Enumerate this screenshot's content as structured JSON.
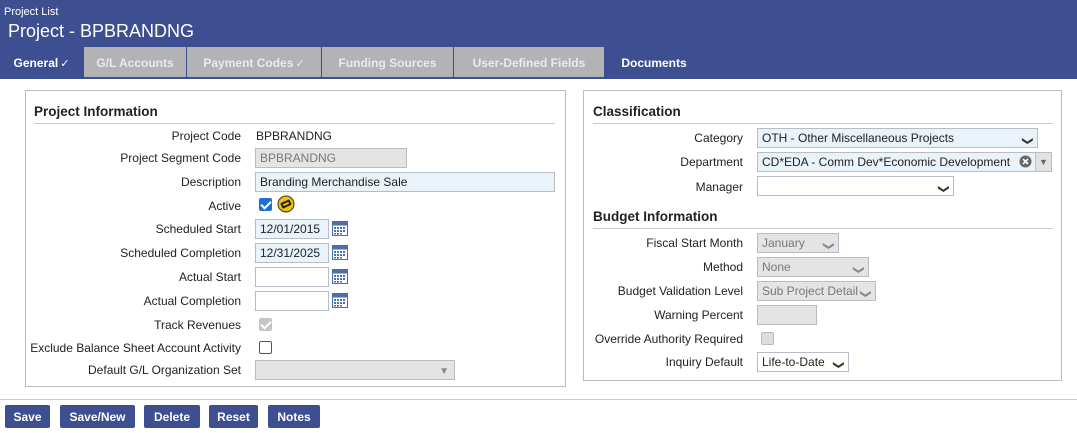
{
  "header": {
    "breadcrumb": "Project List",
    "title": "Project - BPBRANDNG"
  },
  "tabs": [
    {
      "label": "General",
      "check": "✓"
    },
    {
      "label": "G/L Accounts",
      "check": ""
    },
    {
      "label": "Payment Codes",
      "check": "✓"
    },
    {
      "label": "Funding Sources",
      "check": ""
    },
    {
      "label": "User-Defined Fields",
      "check": ""
    },
    {
      "label": "Documents",
      "check": ""
    }
  ],
  "project_info": {
    "title": "Project Information",
    "project_code_label": "Project Code",
    "project_code_value": "BPBRANDNG",
    "segment_code_label": "Project Segment Code",
    "segment_code_value": "BPBRANDNG",
    "description_label": "Description",
    "description_value": "Branding Merchandise Sale",
    "active_label": "Active",
    "active_checked": true,
    "scheduled_start_label": "Scheduled Start",
    "scheduled_start_value": "12/01/2015",
    "scheduled_completion_label": "Scheduled Completion",
    "scheduled_completion_value": "12/31/2025",
    "actual_start_label": "Actual Start",
    "actual_start_value": "",
    "actual_completion_label": "Actual Completion",
    "actual_completion_value": "",
    "track_revenues_label": "Track Revenues",
    "track_revenues_checked": true,
    "exclude_bs_label": "Exclude Balance Sheet Account Activity",
    "exclude_bs_checked": false,
    "default_org_set_label": "Default G/L Organization Set",
    "default_org_set_value": ""
  },
  "classification": {
    "title": "Classification",
    "category_label": "Category",
    "category_value": "OTH - Other Miscellaneous Projects",
    "department_label": "Department",
    "department_value": "CD*EDA - Comm Dev*Economic Development",
    "manager_label": "Manager",
    "manager_value": ""
  },
  "budget_info": {
    "title": "Budget Information",
    "fiscal_start_label": "Fiscal Start Month",
    "fiscal_start_value": "January",
    "method_label": "Method",
    "method_value": "None",
    "validation_label": "Budget Validation Level",
    "validation_value": "Sub Project Detail",
    "warning_label": "Warning Percent",
    "warning_value": "",
    "override_label": "Override Authority Required",
    "override_checked": false,
    "inquiry_label": "Inquiry Default",
    "inquiry_value": "Life-to-Date"
  },
  "buttons": {
    "save": "Save",
    "save_new": "Save/New",
    "delete": "Delete",
    "reset": "Reset",
    "notes": "Notes"
  },
  "colors": {
    "header": "#3d4f91",
    "tab_inactive": "#b3b3b6",
    "button": "#3d4f91",
    "checkbox_on": "#1f6fd1"
  }
}
